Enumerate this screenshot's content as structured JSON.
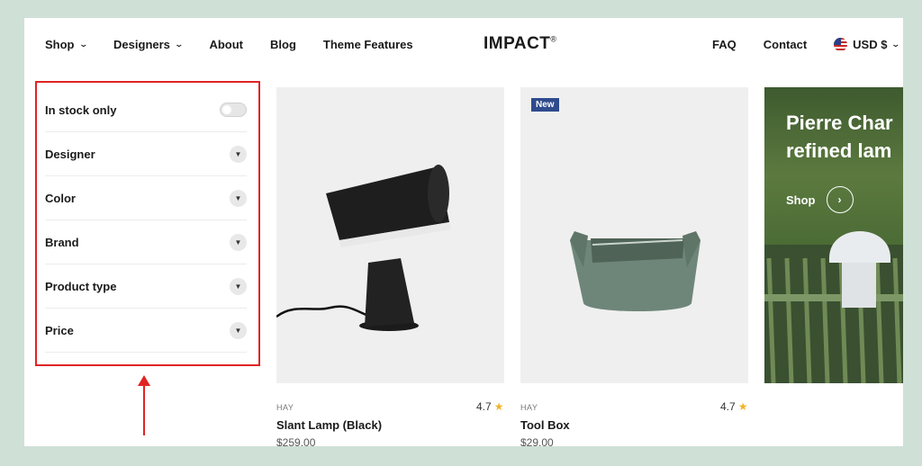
{
  "header": {
    "nav_left": [
      {
        "label": "Shop",
        "has_dropdown": true
      },
      {
        "label": "Designers",
        "has_dropdown": true
      },
      {
        "label": "About",
        "has_dropdown": false
      },
      {
        "label": "Blog",
        "has_dropdown": false
      },
      {
        "label": "Theme Features",
        "has_dropdown": false
      }
    ],
    "logo": "IMPACT",
    "logo_mark": "®",
    "nav_right": {
      "faq": "FAQ",
      "contact": "Contact",
      "currency": "USD $"
    }
  },
  "filters": {
    "in_stock_label": "In stock only",
    "in_stock_enabled": false,
    "items": [
      "Designer",
      "Color",
      "Brand",
      "Product type",
      "Price"
    ]
  },
  "products": [
    {
      "brand": "HAY",
      "name": "Slant Lamp (Black)",
      "price": "$259.00",
      "rating": "4.7",
      "badge": ""
    },
    {
      "brand": "HAY",
      "name": "Tool Box",
      "price": "$29.00",
      "rating": "4.7",
      "badge": "New"
    }
  ],
  "promo": {
    "title_line1": "Pierre Char",
    "title_line2": "refined lam",
    "shop_label": "Shop"
  },
  "colors": {
    "annotation_red": "#e02424",
    "badge_blue": "#2f4b8d",
    "star": "#f0b429",
    "background": "#cfe0d6"
  }
}
